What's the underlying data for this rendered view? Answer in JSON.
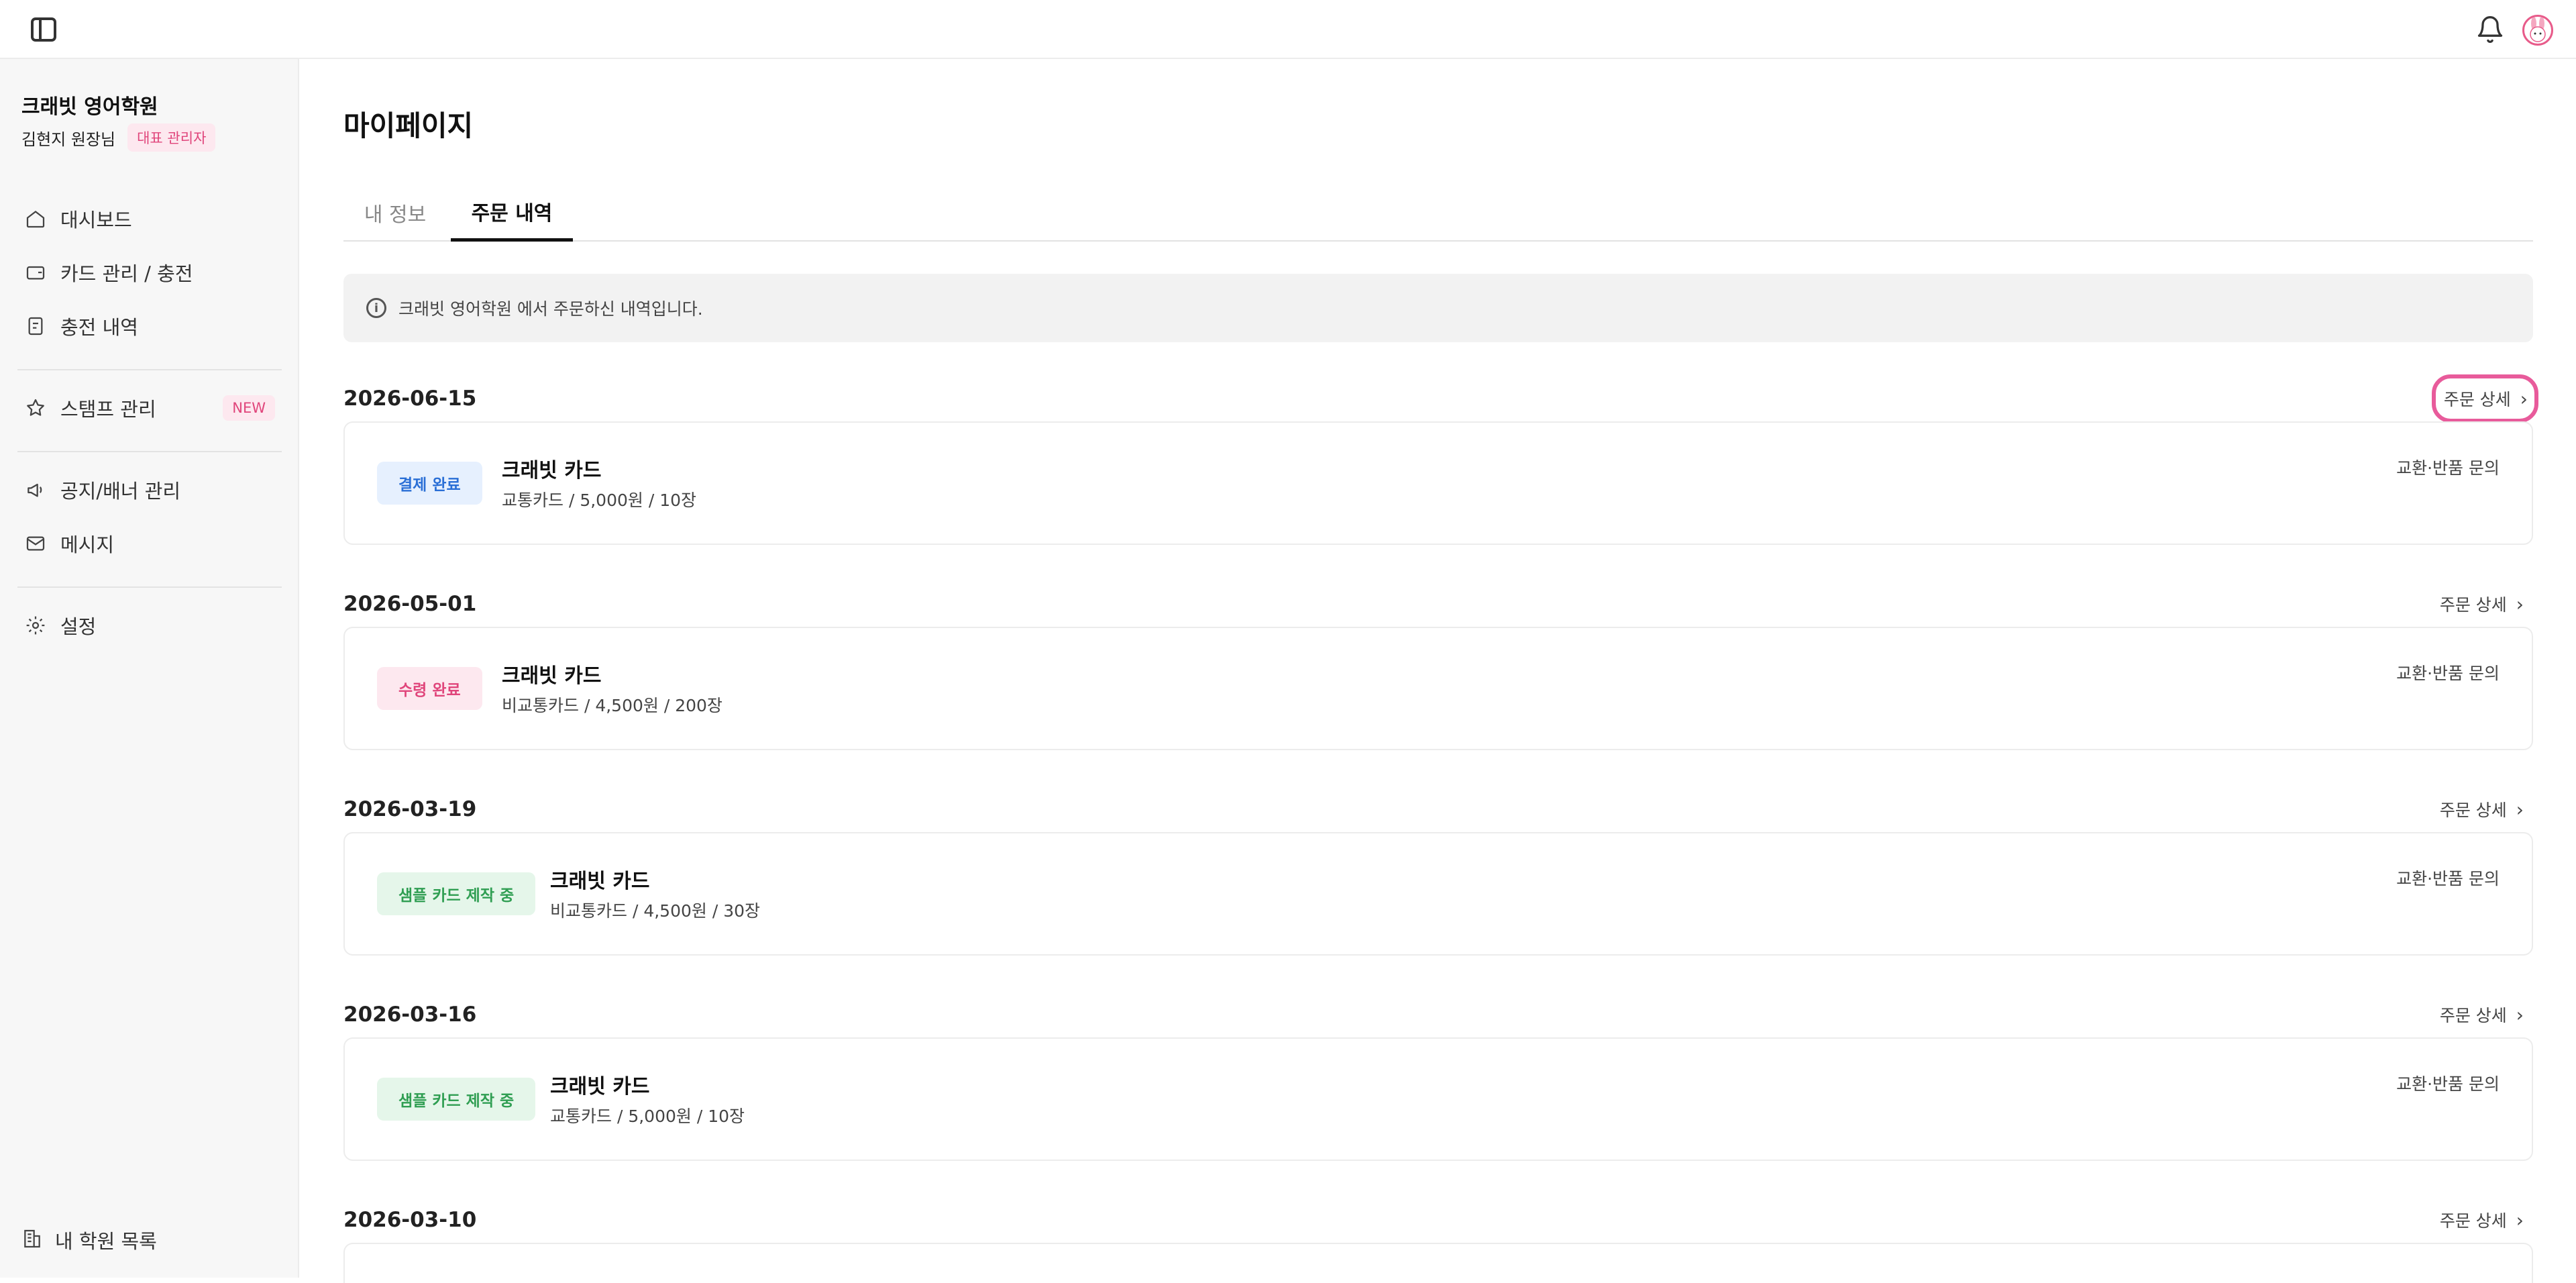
{
  "sidebar": {
    "org_name": "크래빗 영어학원",
    "user_name": "김현지 원장님",
    "role_badge": "대표 관리자",
    "items": [
      {
        "label": "대시보드",
        "icon": "home-icon"
      },
      {
        "label": "카드 관리 / 충전",
        "icon": "wallet-icon"
      },
      {
        "label": "충전 내역",
        "icon": "receipt-icon"
      },
      {
        "label": "스탬프 관리",
        "icon": "star-icon",
        "badge": "NEW"
      },
      {
        "label": "공지/배너 관리",
        "icon": "megaphone-icon"
      },
      {
        "label": "메시지",
        "icon": "mail-icon"
      },
      {
        "label": "설정",
        "icon": "gear-icon"
      }
    ],
    "footer_label": "내 학원 목록"
  },
  "main": {
    "title": "마이페이지",
    "tabs": [
      {
        "label": "내 정보",
        "active": false
      },
      {
        "label": "주문 내역",
        "active": true
      }
    ],
    "notice": "크래빗 영어학원 에서 주문하신 내역입니다.",
    "detail_label": "주문 상세",
    "inquiry_label": "교환·반품 문의",
    "orders": [
      {
        "date": "2026-06-15",
        "status": "결제 완료",
        "status_type": "paid",
        "product": "크래빗 카드",
        "desc": "교통카드 / 5,000원 / 10장"
      },
      {
        "date": "2026-05-01",
        "status": "수령 완료",
        "status_type": "received",
        "product": "크래빗 카드",
        "desc": "비교통카드 / 4,500원 / 200장"
      },
      {
        "date": "2026-03-19",
        "status": "샘플 카드 제작 중",
        "status_type": "sample",
        "product": "크래빗 카드",
        "desc": "비교통카드 / 4,500원 / 30장"
      },
      {
        "date": "2026-03-16",
        "status": "샘플 카드 제작 중",
        "status_type": "sample",
        "product": "크래빗 카드",
        "desc": "교통카드 / 5,000원 / 10장"
      },
      {
        "date": "2026-03-10"
      }
    ]
  },
  "colors": {
    "accent_pink": "#e0457b",
    "highlight_ring": "#e85b9b",
    "paid_blue": "#2a6fd6",
    "sample_green": "#2f9e52"
  }
}
